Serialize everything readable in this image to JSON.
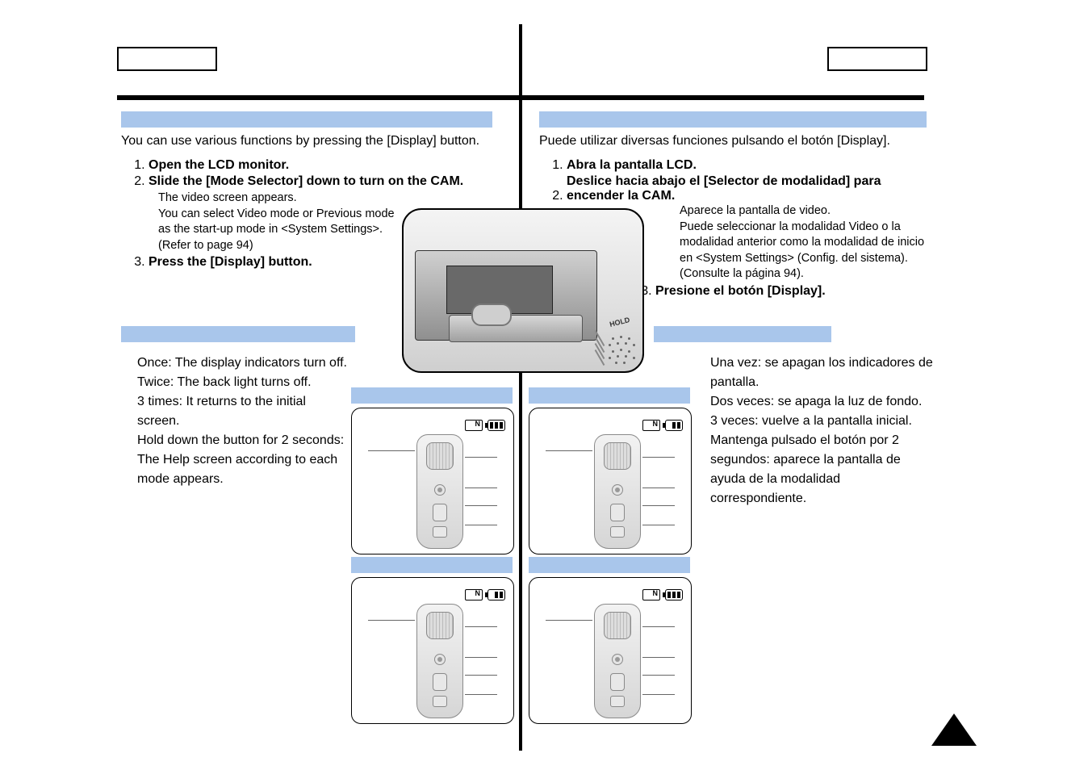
{
  "left": {
    "intro": "You can use various functions by pressing the [Display] button.",
    "step1": "Open the LCD monitor.",
    "step2": "Slide the [Mode Selector] down to turn on the CAM.",
    "step2_sub1": "The video screen appears.",
    "step2_sub2": "You can select Video mode or Previous mode as the start-up mode in <System Settings>. (Refer to page 94)",
    "step3": "Press the [Display] button.",
    "desc_once": "Once: The display indicators turn off.",
    "desc_twice": "Twice: The back light turns off.",
    "desc_three": "3 times: It returns to the initial screen.",
    "desc_hold": "Hold down the button for 2 seconds: The Help screen according to each mode appears."
  },
  "right": {
    "intro": "Puede utilizar diversas funciones pulsando el botón [Display].",
    "step1": "Abra la pantalla LCD.",
    "step2": "Deslice hacia abajo el [Selector de modalidad] para encender la CAM.",
    "step2_sub1": "Aparece la pantalla de video.",
    "step2_sub2": "Puede seleccionar la modalidad Video o la modalidad anterior como la modalidad de inicio en <System Settings> (Config. del sistema). (Consulte la página 94).",
    "step3": "Presione el botón [Display].",
    "desc_once": "Una vez: se apagan los indicadores de pantalla.",
    "desc_twice": "Dos veces: se apaga la luz de fondo.",
    "desc_three": "3 veces: vuelve a la pantalla inicial.",
    "desc_hold": "Mantenga pulsado el botón por 2 segundos: aparece la pantalla de ayuda de la modalidad correspondiente."
  },
  "photo": {
    "hold_label": "HOLD"
  },
  "diag_icon": {
    "n": "N"
  }
}
